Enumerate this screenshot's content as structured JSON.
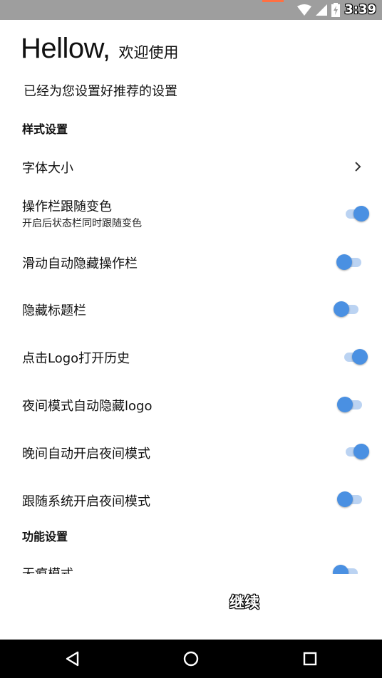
{
  "status_bar": {
    "time": "3:39",
    "icons": [
      "wifi-icon",
      "signal-icon",
      "battery-charging-icon"
    ]
  },
  "header": {
    "greeting": "Hellow,",
    "welcome": "欢迎使用",
    "subtitle": "已经为您设置好推荐的设置"
  },
  "sections": {
    "style": "样式设置",
    "function": "功能设置"
  },
  "settings": {
    "font_size": {
      "label": "字体大小",
      "type": "link"
    },
    "toolbar_color": {
      "label": "操作栏跟随变色",
      "desc": "开启后状态栏同时跟随变色",
      "on": true
    },
    "scroll_hide_toolbar": {
      "label": "滑动自动隐藏操作栏",
      "on": false
    },
    "hide_titlebar": {
      "label": "隐藏标题栏",
      "on": false
    },
    "logo_history": {
      "label": "点击Logo打开历史",
      "on": true
    },
    "night_hide_logo": {
      "label": "夜间模式自动隐藏logo",
      "on": false
    },
    "night_auto": {
      "label": "晚间自动开启夜间模式",
      "on": true
    },
    "follow_system_night": {
      "label": "跟随系统开启夜间模式",
      "on": false
    },
    "incognito": {
      "label": "无痕模式",
      "on": false
    }
  },
  "footer": {
    "continue_label": "继续"
  },
  "colors": {
    "accent": "#4a90e2",
    "track": "#bbd3f2",
    "status_bar": "#9e9e9e",
    "nav_bar": "#000000"
  },
  "nav": [
    "back-icon",
    "home-icon",
    "recents-icon"
  ]
}
